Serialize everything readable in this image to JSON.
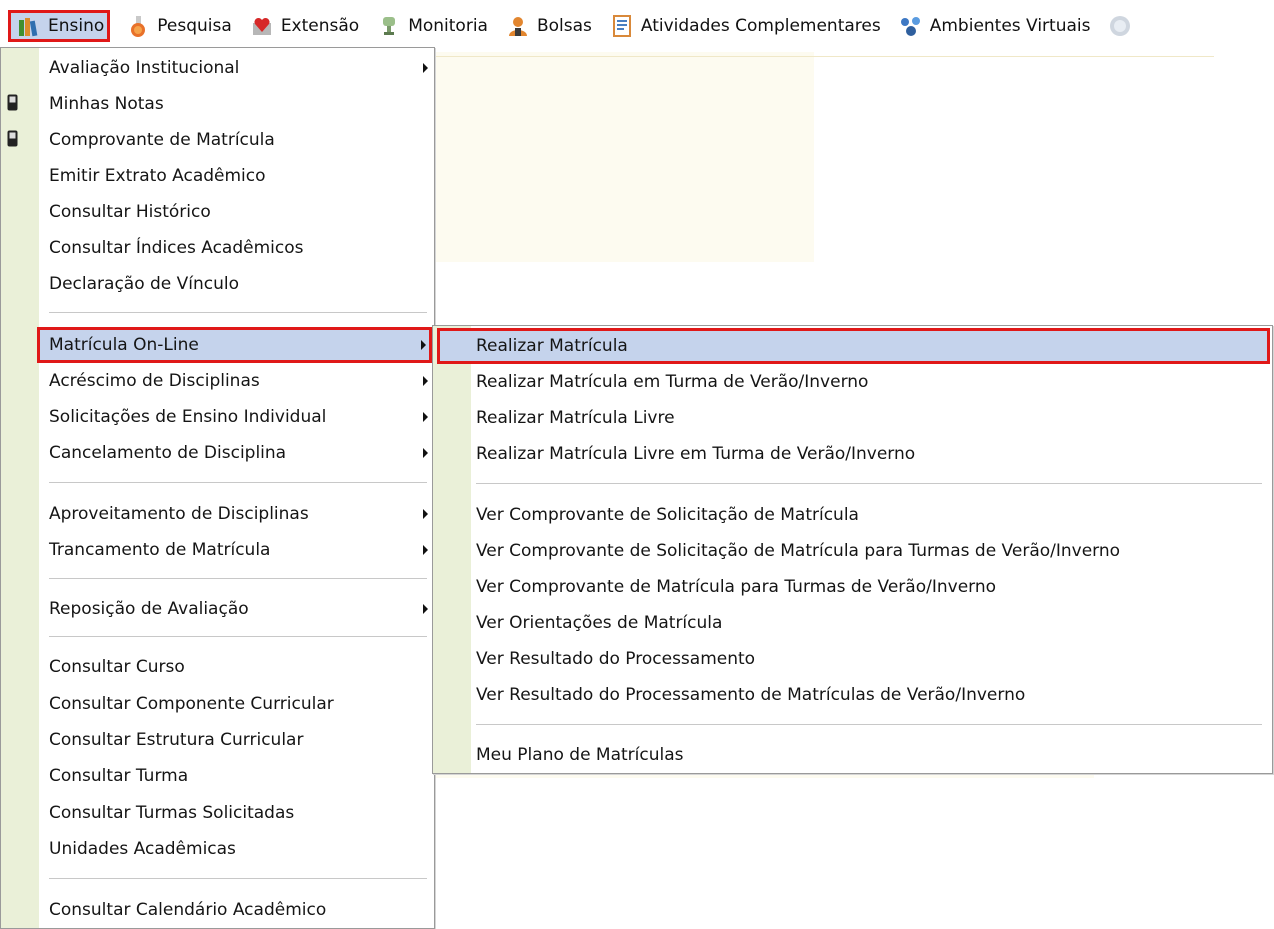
{
  "menubar": {
    "items": [
      {
        "label": "Ensino",
        "icon": "books-icon"
      },
      {
        "label": "Pesquisa",
        "icon": "flask-icon"
      },
      {
        "label": "Extensão",
        "icon": "heart-box-icon"
      },
      {
        "label": "Monitoria",
        "icon": "trophy-icon"
      },
      {
        "label": "Bolsas",
        "icon": "user-icon"
      },
      {
        "label": "Atividades Complementares",
        "icon": "document-icon"
      },
      {
        "label": "Ambientes Virtuais",
        "icon": "network-icon"
      }
    ]
  },
  "ensino_menu": {
    "items": [
      {
        "label": "Avaliação Institucional",
        "submenu": true
      },
      {
        "label": "Minhas Notas",
        "icon": "phone-icon"
      },
      {
        "label": "Comprovante de Matrícula",
        "icon": "phone-icon"
      },
      {
        "label": "Emitir Extrato Acadêmico"
      },
      {
        "label": "Consultar Histórico"
      },
      {
        "label": "Consultar Índices Acadêmicos"
      },
      {
        "label": "Declaração de Vínculo"
      },
      {
        "label": "Matrícula On-Line",
        "submenu": true,
        "highlighted": true
      },
      {
        "label": "Acréscimo de Disciplinas",
        "submenu": true
      },
      {
        "label": "Solicitações de Ensino Individual",
        "submenu": true
      },
      {
        "label": "Cancelamento de Disciplina",
        "submenu": true
      },
      {
        "label": "Aproveitamento de Disciplinas",
        "submenu": true
      },
      {
        "label": "Trancamento de Matrícula",
        "submenu": true
      },
      {
        "label": "Reposição de Avaliação",
        "submenu": true
      },
      {
        "label": "Consultar Curso"
      },
      {
        "label": "Consultar Componente Curricular"
      },
      {
        "label": "Consultar Estrutura Curricular"
      },
      {
        "label": "Consultar Turma"
      },
      {
        "label": "Consultar Turmas Solicitadas"
      },
      {
        "label": "Unidades Acadêmicas"
      },
      {
        "label": "Consultar Calendário Acadêmico"
      }
    ]
  },
  "matricula_submenu": {
    "items": [
      {
        "label": "Realizar Matrícula",
        "highlighted": true
      },
      {
        "label": "Realizar Matrícula em Turma de Verão/Inverno"
      },
      {
        "label": "Realizar Matrícula Livre"
      },
      {
        "label": "Realizar Matrícula Livre em Turma de Verão/Inverno"
      },
      {
        "label": "Ver Comprovante de Solicitação de Matrícula"
      },
      {
        "label": "Ver Comprovante de Solicitação de Matrícula para Turmas de Verão/Inverno"
      },
      {
        "label": "Ver Comprovante de Matrícula para Turmas de Verão/Inverno"
      },
      {
        "label": "Ver Orientações de Matrícula"
      },
      {
        "label": "Ver Resultado do Processamento"
      },
      {
        "label": "Ver Resultado do Processamento de Matrículas de Verão/Inverno"
      },
      {
        "label": "Meu Plano de Matrículas"
      }
    ]
  },
  "colors": {
    "highlight_bg": "#c5d3ec",
    "highlight_border": "#e01818",
    "gutter": "#eaf0d8"
  }
}
